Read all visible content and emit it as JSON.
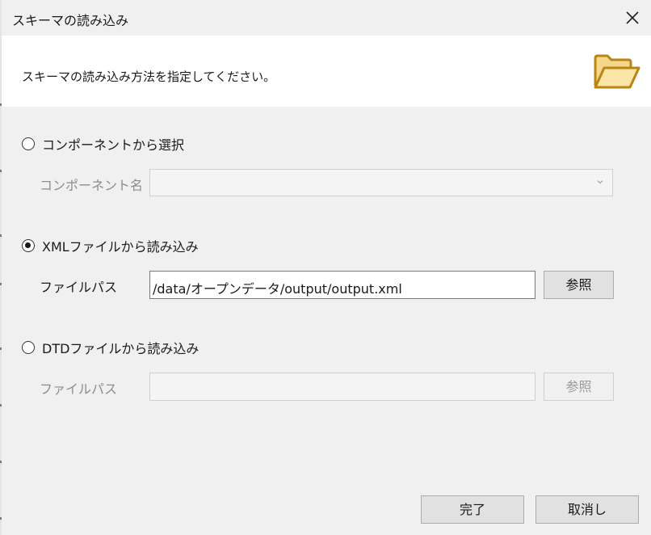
{
  "window": {
    "title": "スキーマの読み込み"
  },
  "header": {
    "instruction": "スキーマの読み込み方法を指定してください。",
    "icon": "folder-open-icon",
    "icon_color": "#e8b84a"
  },
  "options": {
    "component": {
      "label": "コンポーネントから選択",
      "selected": false,
      "field_label": "コンポーネント名",
      "value": ""
    },
    "xml": {
      "label": "XMLファイルから読み込み",
      "selected": true,
      "field_label": "ファイルパス",
      "value": "/data/オープンデータ/output/output.xml",
      "browse_label": "参照"
    },
    "dtd": {
      "label": "DTDファイルから読み込み",
      "selected": false,
      "field_label": "ファイルパス",
      "value": "",
      "browse_label": "参照"
    }
  },
  "footer": {
    "ok_label": "完了",
    "cancel_label": "取消し"
  }
}
